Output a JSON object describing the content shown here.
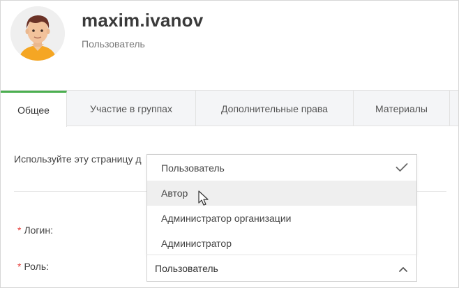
{
  "user": {
    "name": "maxim.ivanov",
    "role": "Пользователь"
  },
  "tabs": [
    {
      "label": "Общее",
      "active": true
    },
    {
      "label": "Участие в группах",
      "active": false
    },
    {
      "label": "Дополнительные права",
      "active": false
    },
    {
      "label": "Материалы",
      "active": false
    }
  ],
  "general": {
    "hint": "Используйте эту страницу д"
  },
  "fields": {
    "login_label": "Логин:",
    "role_label": "Роль:",
    "required_mark": "*"
  },
  "role_select": {
    "selected": "Пользователь",
    "options": [
      {
        "label": "Пользователь",
        "selected": true,
        "hovered": false
      },
      {
        "label": "Автор",
        "selected": false,
        "hovered": true
      },
      {
        "label": "Администратор организации",
        "selected": false,
        "hovered": false
      },
      {
        "label": "Администратор",
        "selected": false,
        "hovered": false
      }
    ]
  },
  "colors": {
    "accent": "#4caf50",
    "required": "#e53935"
  },
  "icons": {
    "check": "check-icon",
    "chevron": "chevron-up-icon",
    "cursor": "mouse-cursor-icon"
  }
}
